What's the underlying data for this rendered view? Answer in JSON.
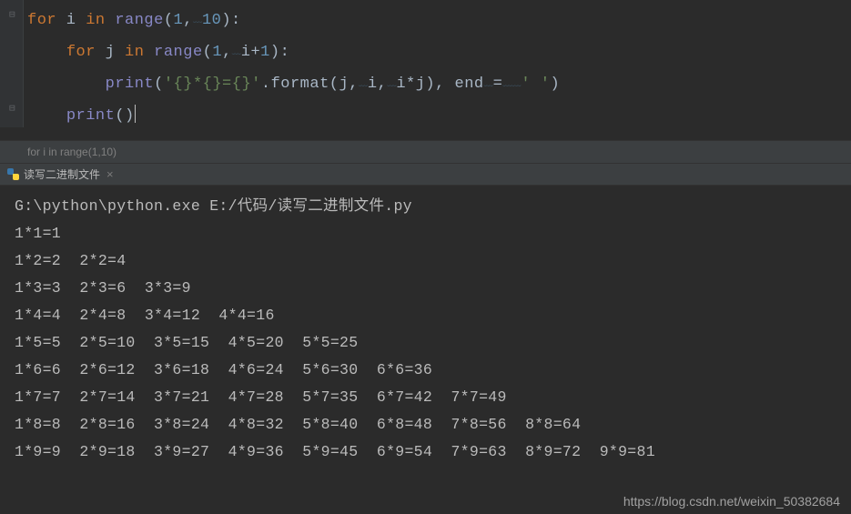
{
  "code": {
    "line1": {
      "kw_for": "for",
      "var": " i ",
      "kw_in": "in",
      "sp": " ",
      "fn": "range",
      "p1": "(",
      "n1": "1",
      "c": ",",
      "n2": "10",
      "p2": "):"
    },
    "line2": {
      "kw_for": "for",
      "var": " j ",
      "kw_in": "in",
      "sp": " ",
      "fn": "range",
      "p1": "(",
      "n1": "1",
      "c": ",",
      "expr": "i+",
      "n2": "1",
      "p2": "):"
    },
    "line3": {
      "fn": "print",
      "p1": "(",
      "str": "'{}*{}={}'",
      "dot": ".format(j",
      "c1": ",",
      "v2": "i",
      "c2": ",",
      "v3": "i*j)",
      "c3": ",",
      "sp2": " end",
      "eq": "=",
      "str2": "'  '",
      "p2": ")"
    },
    "line4": {
      "fn": "print",
      "p": "()"
    }
  },
  "breadcrumb": "for i in range(1,10)",
  "tab": {
    "name": "读写二进制文件",
    "close": "×"
  },
  "console": {
    "cmd": "G:\\python\\python.exe E:/代码/读写二进制文件.py",
    "lines": [
      "1*1=1",
      "1*2=2  2*2=4",
      "1*3=3  2*3=6  3*3=9",
      "1*4=4  2*4=8  3*4=12  4*4=16",
      "1*5=5  2*5=10  3*5=15  4*5=20  5*5=25",
      "1*6=6  2*6=12  3*6=18  4*6=24  5*6=30  6*6=36",
      "1*7=7  2*7=14  3*7=21  4*7=28  5*7=35  6*7=42  7*7=49",
      "1*8=8  2*8=16  3*8=24  4*8=32  5*8=40  6*8=48  7*8=56  8*8=64",
      "1*9=9  2*9=18  3*9=27  4*9=36  5*9=45  6*9=54  7*9=63  8*9=72  9*9=81"
    ]
  },
  "watermark": "https://blog.csdn.net/weixin_50382684"
}
